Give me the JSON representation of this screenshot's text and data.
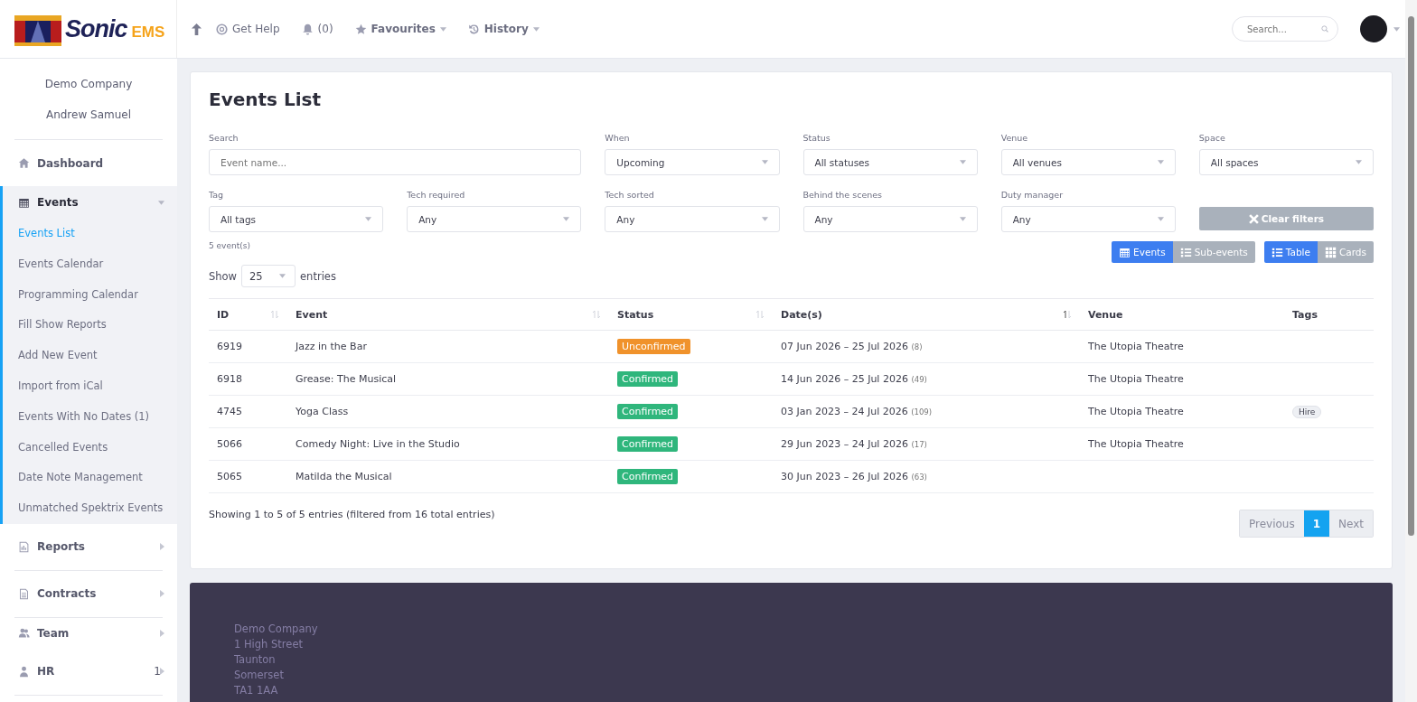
{
  "logo": {
    "name": "Sonic",
    "suffix": "EMS"
  },
  "topnav": [
    {
      "kind": "help",
      "label": "Get Help",
      "dropdown": false
    },
    {
      "kind": "alerts",
      "label": "(0)",
      "dropdown": false
    },
    {
      "kind": "favourites",
      "label": "Favourites",
      "dropdown": true
    },
    {
      "kind": "history",
      "label": "History",
      "dropdown": true
    }
  ],
  "header_search": {
    "placeholder": "Search..."
  },
  "sidebar": {
    "company": "Demo Company",
    "user": "Andrew Samuel",
    "items": [
      {
        "kind": "home",
        "label": "Dashboard",
        "expanded": false
      },
      {
        "kind": "calendar",
        "label": "Events",
        "expanded": true,
        "children": [
          {
            "label": "Events List",
            "selected": true
          },
          {
            "label": "Events Calendar",
            "selected": false
          },
          {
            "label": "Programming Calendar",
            "selected": false
          },
          {
            "label": "Fill Show Reports",
            "selected": false
          },
          {
            "label": "Add New Event",
            "selected": false
          },
          {
            "label": "Import from iCal",
            "selected": false
          },
          {
            "label": "Events With No Dates (1)",
            "selected": false
          },
          {
            "label": "Cancelled Events",
            "selected": false
          },
          {
            "label": "Date Note Management",
            "selected": false
          },
          {
            "label": "Unmatched Spektrix Events",
            "selected": false
          }
        ]
      },
      {
        "kind": "chart",
        "label": "Reports",
        "expanded": false
      },
      {
        "kind": "document",
        "label": "Contracts",
        "expanded": false
      },
      {
        "kind": "people",
        "label": "Team",
        "expanded": false
      },
      {
        "kind": "person",
        "label": "HR",
        "expanded": false,
        "badge": "1"
      }
    ]
  },
  "page_title": "Events List",
  "filters": [
    {
      "kind": "text",
      "label": "Search",
      "placeholder": "Event name..."
    },
    {
      "kind": "select",
      "label": "When",
      "value": "Upcoming"
    },
    {
      "kind": "select",
      "label": "Status",
      "value": "All statuses"
    },
    {
      "kind": "select",
      "label": "Venue",
      "value": "All venues"
    },
    {
      "kind": "select",
      "label": "Space",
      "value": "All spaces"
    },
    {
      "kind": "select",
      "label": "Tag",
      "value": "All tags"
    },
    {
      "kind": "select",
      "label": "Tech required",
      "value": "Any"
    },
    {
      "kind": "select",
      "label": "Tech sorted",
      "value": "Any"
    },
    {
      "kind": "select",
      "label": "Behind the scenes",
      "value": "Any"
    },
    {
      "kind": "select",
      "label": "Duty manager",
      "value": "Any"
    }
  ],
  "clear_filters": "Clear filters",
  "event_count": "5 event(s)",
  "toggle_groups": [
    [
      {
        "kind": "calendar",
        "label": "Events",
        "selected": true
      },
      {
        "kind": "list",
        "label": "Sub-events",
        "selected": false
      }
    ],
    [
      {
        "kind": "list",
        "label": "Table",
        "selected": true
      },
      {
        "kind": "grid",
        "label": "Cards",
        "selected": false
      }
    ]
  ],
  "show_entries": {
    "before": "Show",
    "value": "25",
    "after": "entries"
  },
  "table": {
    "columns": [
      {
        "label": "ID",
        "sortable": true,
        "sorted": false
      },
      {
        "label": "Event",
        "sortable": true,
        "sorted": false
      },
      {
        "label": "Status",
        "sortable": true,
        "sorted": false
      },
      {
        "label": "Date(s)",
        "sortable": true,
        "sorted": true
      },
      {
        "label": "Venue",
        "sortable": false
      },
      {
        "label": "Tags",
        "sortable": false
      }
    ],
    "rows": [
      {
        "id": "6919",
        "event": "Jazz in the Bar",
        "status": {
          "kind": "unconfirmed",
          "label": "Unconfirmed"
        },
        "dates": "07 Jun 2026 – 25 Jul 2026",
        "count": "(8)",
        "venue": "The Utopia Theatre",
        "tags": []
      },
      {
        "id": "6918",
        "event": "Grease: The Musical",
        "status": {
          "kind": "confirmed",
          "label": "Confirmed"
        },
        "dates": "14 Jun 2026 – 25 Jul 2026",
        "count": "(49)",
        "venue": "The Utopia Theatre",
        "tags": []
      },
      {
        "id": "4745",
        "event": "Yoga Class",
        "status": {
          "kind": "confirmed",
          "label": "Confirmed"
        },
        "dates": "03 Jan 2023 – 24 Jul 2026",
        "count": "(109)",
        "venue": "The Utopia Theatre",
        "tags": [
          "Hire"
        ]
      },
      {
        "id": "5066",
        "event": "Comedy Night: Live in the Studio",
        "status": {
          "kind": "confirmed",
          "label": "Confirmed"
        },
        "dates": "29 Jun 2023 – 24 Jul 2026",
        "count": "(17)",
        "venue": "The Utopia Theatre",
        "tags": []
      },
      {
        "id": "5065",
        "event": "Matilda the Musical",
        "status": {
          "kind": "confirmed",
          "label": "Confirmed"
        },
        "dates": "30 Jun 2023 – 26 Jul 2026",
        "count": "(63)",
        "venue": "",
        "tags": []
      }
    ]
  },
  "table_info": "Showing 1 to 5 of 5 entries (filtered from 16 total entries)",
  "pagination": [
    {
      "label": "Previous",
      "selected": false
    },
    {
      "label": "1",
      "selected": true
    },
    {
      "label": "Next",
      "selected": false
    }
  ],
  "footer": [
    "Demo Company",
    "1 High Street",
    "Taunton",
    "Somerset",
    "TA1 1AA"
  ]
}
